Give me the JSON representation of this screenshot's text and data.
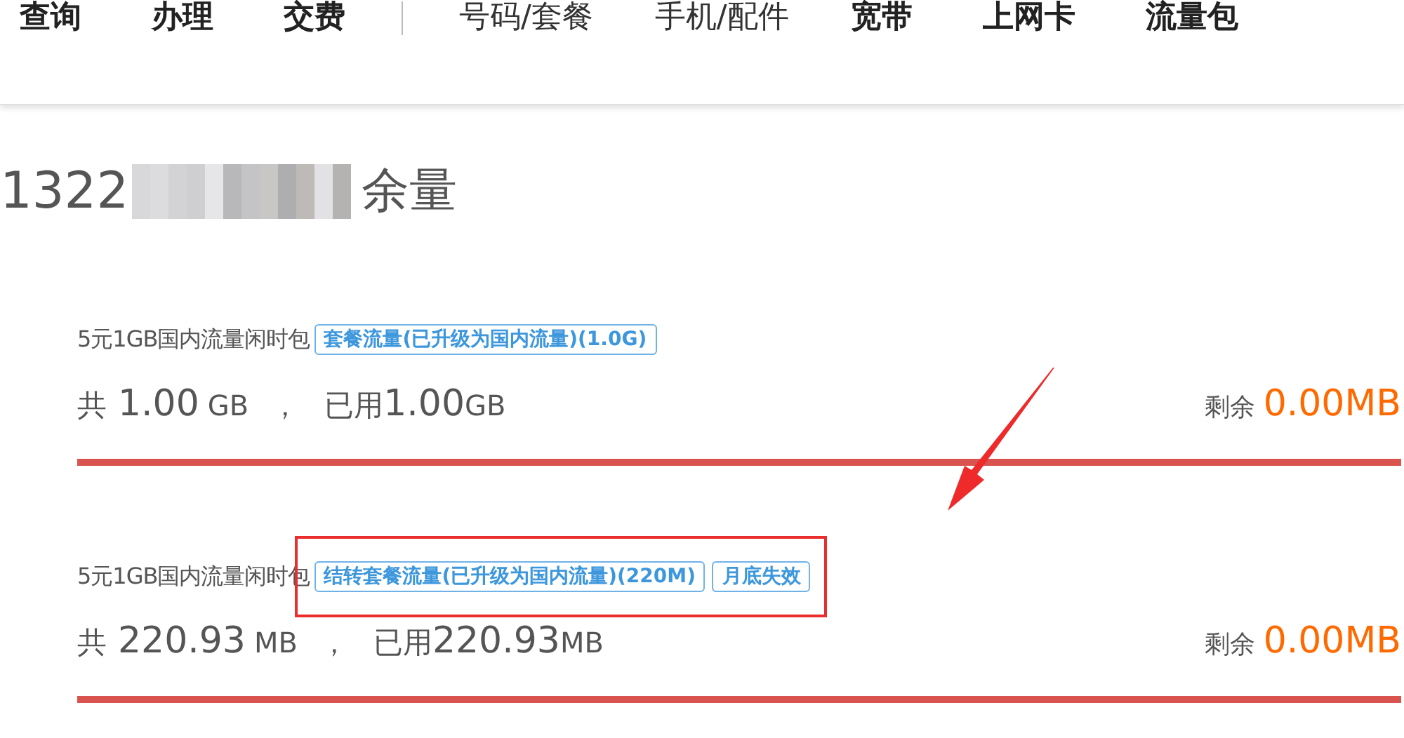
{
  "nav": [
    {
      "label": "查询",
      "kind": "primary"
    },
    {
      "label": "办理",
      "kind": "primary"
    },
    {
      "label": "交费",
      "kind": "primary"
    },
    {
      "kind": "divider"
    },
    {
      "label": "号码/套餐",
      "kind": "secondary"
    },
    {
      "label": "手机/配件",
      "kind": "secondary"
    },
    {
      "label": "宽带",
      "kind": "primary"
    },
    {
      "label": "上网卡",
      "kind": "primary"
    },
    {
      "label": "流量包",
      "kind": "primary"
    }
  ],
  "heading": {
    "number": "1322",
    "masked": true,
    "label": "余量"
  },
  "packages": [
    {
      "name": "5元1GB国内流量闲时包",
      "tags": [
        "套餐流量(已升级为国内流量)(1.0G)"
      ],
      "total_label": "共",
      "total_value": "1.00",
      "total_unit": "GB",
      "separator": "，",
      "used_label": "已用",
      "used_value": "1.00",
      "used_unit": "GB",
      "remaining_label": "剩余",
      "remaining_value": "0.00MB",
      "level": 1
    },
    {
      "name": "5元1GB国内流量闲时包",
      "tags": [
        "结转套餐流量(已升级为国内流量)(220M)",
        "月底失效"
      ],
      "highlighted": true,
      "total_label": "共",
      "total_value": "220.93",
      "total_unit": "MB",
      "separator": "，",
      "used_label": "已用",
      "used_value": "220.93",
      "used_unit": "MB",
      "remaining_label": "剩余",
      "remaining_value": "0.00MB",
      "level": 1
    }
  ],
  "annotation": {
    "arrow": true
  }
}
